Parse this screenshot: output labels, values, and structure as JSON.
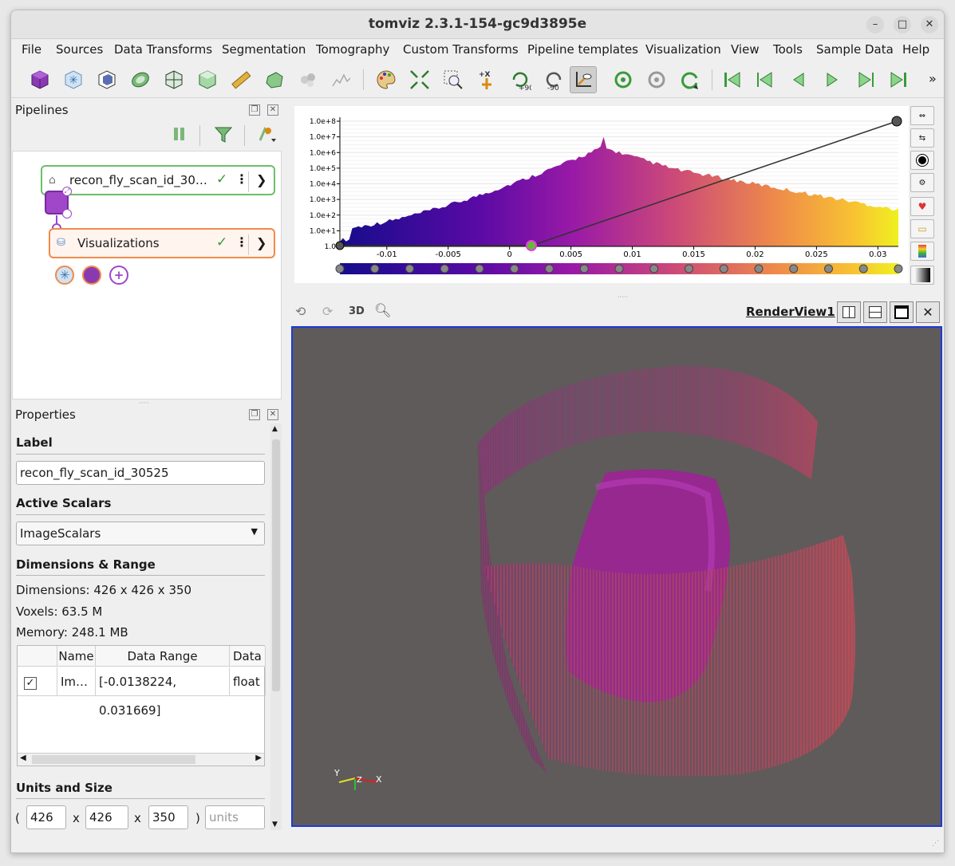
{
  "window": {
    "title": "tomviz 2.3.1-154-gc9d3895e"
  },
  "menu": [
    "File",
    "Sources",
    "Data Transforms",
    "Segmentation",
    "Tomography",
    "Custom Transforms",
    "Pipeline templates",
    "Visualization",
    "View",
    "Tools",
    "Sample Data",
    "Help"
  ],
  "toolbar": {
    "icons": [
      "outline-icon",
      "slice-icon",
      "volume-icon",
      "contour-icon",
      "orthogonal-slice-icon",
      "threshold-icon",
      "ruler-icon",
      "segment-icon",
      "molecule-icon",
      "line-plot-icon",
      "palette-icon",
      "reset-camera-icon",
      "zoom-to-box-icon",
      "set-view-direction-icon",
      "rotate-plus-90-icon",
      "rotate-minus-90-icon",
      "center-axes-icon",
      "reload-icon",
      "reset-icon",
      "redo-icon",
      "first-frame-icon",
      "previous-frame-icon",
      "play-backward-icon",
      "play-icon",
      "next-frame-icon",
      "last-frame-icon"
    ],
    "rot_plus": "+90",
    "rot_minus": "-90",
    "axis_label": "+X",
    "more": "»"
  },
  "pipelines": {
    "title": "Pipelines",
    "source_node": {
      "label": "recon_fly_scan_id_30…"
    },
    "vis_node": {
      "label": "Visualizations"
    },
    "add_label": "+"
  },
  "properties": {
    "title": "Properties",
    "label_section": "Label",
    "label_value": "recon_fly_scan_id_30525",
    "active_scalars_section": "Active Scalars",
    "active_scalars_value": "ImageScalars",
    "dims_section": "Dimensions & Range",
    "dimensions": "Dimensions: 426 x 426 x 350",
    "voxels": "Voxels: 63.5 M",
    "memory": "Memory: 248.1 MB",
    "table": {
      "headers": [
        "",
        "Name",
        "Data Range",
        "Data T"
      ],
      "row": {
        "checked": "✓",
        "name": "Im…",
        "range": "[-0.0138224, 0.031669]",
        "type": "float"
      }
    },
    "units_section": "Units and Size",
    "size": {
      "open": "(",
      "x": "426",
      "sep1": "x",
      "y": "426",
      "sep2": "x",
      "z": "350",
      "close": ")",
      "units_placeholder": "units"
    }
  },
  "histogram": {
    "y_ticks": [
      "1.0e+8",
      "1.0e+7",
      "1.0e+6",
      "1.0e+5",
      "1.0e+4",
      "1.0e+3",
      "1.0e+2",
      "1.0e+1",
      "1.0"
    ],
    "x_ticks": [
      "-0.01",
      "-0.005",
      "0",
      "0.005",
      "0.01",
      "0.015",
      "0.02",
      "0.025",
      "0.03"
    ],
    "side_buttons": [
      "fit-range-icon",
      "custom-range-icon",
      "preset-icon",
      "settings-icon",
      "save-preset-icon",
      "load-preset-icon",
      "color-legend-icon",
      "opacity-gradient-icon"
    ]
  },
  "renderview": {
    "title": "RenderView1",
    "mode_3d": "3D",
    "axes": {
      "y": "Y",
      "z": "Z",
      "x": "X"
    }
  }
}
